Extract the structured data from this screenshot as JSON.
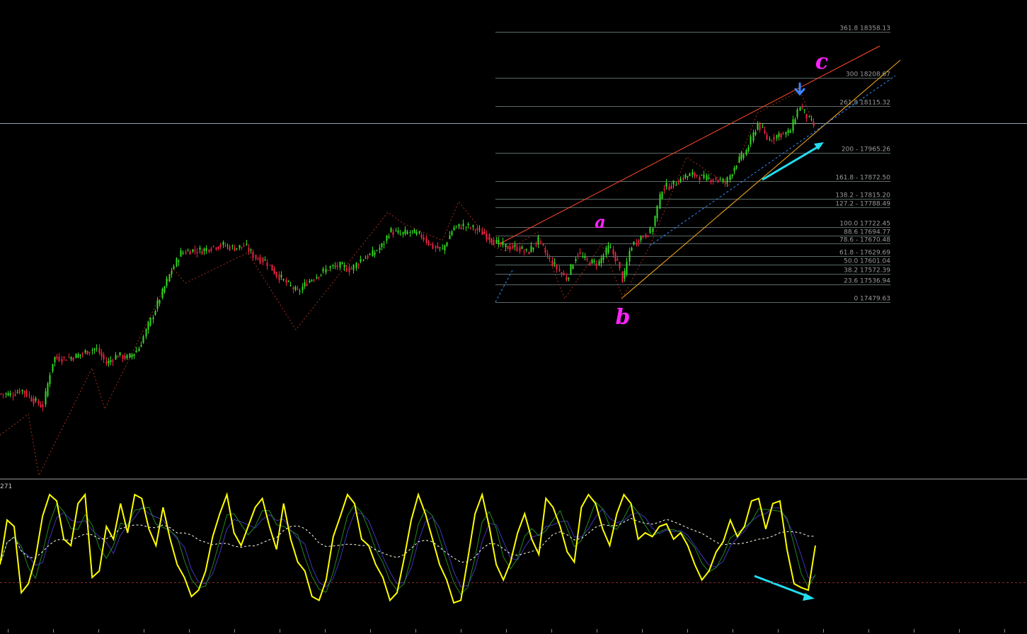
{
  "colors": {
    "background": "#000000",
    "bull_candle": "#33dd22",
    "bear_candle": "#ee2244",
    "fib_lines": "#5c6a6a",
    "fib_text": "#9a9a9a",
    "trend_upper": "#ff4a2a",
    "trend_lower": "#ffb020",
    "channel_dashed": "#2f8fff",
    "zigzag": "#a0301a",
    "crosshair": "#8ea4b0",
    "arrow": "#22ddee",
    "wave_label": "#ff22ff",
    "osc_main": "#ffff00",
    "osc_green": "#1f8a1f",
    "osc_blue": "#4433bb",
    "osc_signal": "#ffffee",
    "osc_zero": "#8a2a2a",
    "top_arrow": "#3a86ff"
  },
  "indicator_header": "271",
  "wave_labels": [
    "a",
    "b",
    "c"
  ],
  "chart_data": [
    {
      "type": "candlestick",
      "fib_levels": [
        {
          "label": "361.8 18358.13",
          "price": 18358.13
        },
        {
          "label": "300 18208.67",
          "price": 18208.67
        },
        {
          "label": "261.8 18115.32",
          "price": 18115.32
        },
        {
          "label": "200 - 17965.26",
          "price": 17965.26
        },
        {
          "label": "161.8 - 17872.50",
          "price": 17872.5
        },
        {
          "label": "138.2 - 17815.20",
          "price": 17815.2
        },
        {
          "label": "127.2 - 17788.49",
          "price": 17788.49
        },
        {
          "label": "100.0 17722.45",
          "price": 17722.45
        },
        {
          "label": "88.6 17694.77",
          "price": 17694.77
        },
        {
          "label": "78.6 - 17670.48",
          "price": 17670.48
        },
        {
          "label": "61.8 - 17629.69",
          "price": 17629.69
        },
        {
          "label": "50.0 17601.04",
          "price": 17601.04
        },
        {
          "label": "38.2 17572.39",
          "price": 17572.39
        },
        {
          "label": "23.6 17536.94",
          "price": 17536.94
        },
        {
          "label": "0 17479.63",
          "price": 17479.63
        }
      ],
      "price_path": [
        [
          0,
          17182
        ],
        [
          15,
          17180
        ],
        [
          30,
          17195
        ],
        [
          45,
          17165
        ],
        [
          60,
          17140
        ],
        [
          75,
          17300
        ],
        [
          90,
          17297
        ],
        [
          105,
          17302
        ],
        [
          120,
          17318
        ],
        [
          135,
          17330
        ],
        [
          150,
          17280
        ],
        [
          165,
          17308
        ],
        [
          180,
          17298
        ],
        [
          195,
          17328
        ],
        [
          210,
          17410
        ],
        [
          225,
          17490
        ],
        [
          240,
          17575
        ],
        [
          255,
          17640
        ],
        [
          270,
          17648
        ],
        [
          285,
          17647
        ],
        [
          300,
          17660
        ],
        [
          315,
          17665
        ],
        [
          330,
          17655
        ],
        [
          345,
          17663
        ],
        [
          360,
          17625
        ],
        [
          375,
          17612
        ],
        [
          390,
          17570
        ],
        [
          405,
          17540
        ],
        [
          420,
          17512
        ],
        [
          435,
          17548
        ],
        [
          450,
          17570
        ],
        [
          465,
          17592
        ],
        [
          480,
          17598
        ],
        [
          495,
          17585
        ],
        [
          510,
          17620
        ],
        [
          525,
          17635
        ],
        [
          540,
          17665
        ],
        [
          550,
          17712
        ],
        [
          565,
          17700
        ],
        [
          580,
          17708
        ],
        [
          595,
          17695
        ],
        [
          610,
          17660
        ],
        [
          625,
          17650
        ],
        [
          640,
          17722
        ],
        [
          655,
          17728
        ],
        [
          670,
          17718
        ],
        [
          685,
          17700
        ],
        [
          700,
          17672
        ],
        [
          715,
          17659
        ],
        [
          730,
          17657
        ],
        [
          745,
          17640
        ],
        [
          760,
          17680
        ],
        [
          775,
          17620
        ],
        [
          790,
          17580
        ],
        [
          800,
          17555
        ],
        [
          815,
          17640
        ],
        [
          830,
          17610
        ],
        [
          845,
          17606
        ],
        [
          860,
          17660
        ],
        [
          872,
          17610
        ],
        [
          880,
          17545
        ],
        [
          890,
          17660
        ],
        [
          905,
          17690
        ],
        [
          920,
          17710
        ],
        [
          935,
          17850
        ],
        [
          950,
          17860
        ],
        [
          965,
          17885
        ],
        [
          980,
          17895
        ],
        [
          995,
          17880
        ],
        [
          1010,
          17880
        ],
        [
          1025,
          17868
        ],
        [
          1040,
          17930
        ],
        [
          1055,
          17975
        ],
        [
          1070,
          18060
        ],
        [
          1085,
          18005
        ],
        [
          1100,
          18025
        ],
        [
          1115,
          18030
        ],
        [
          1125,
          18095
        ],
        [
          1130,
          18118
        ],
        [
          1140,
          18080
        ],
        [
          1152,
          18045
        ]
      ]
    },
    {
      "type": "line",
      "series": [
        {
          "values": [
            40,
            75,
            70,
            18,
            25,
            45,
            78,
            95,
            90,
            60,
            55,
            88,
            95,
            30,
            35,
            70,
            60,
            88,
            65,
            95,
            92,
            68,
            55,
            85,
            60,
            40,
            30,
            15,
            20,
            35,
            62,
            80,
            95,
            65,
            55,
            70,
            85,
            92,
            70,
            52,
            88,
            60,
            42,
            35,
            15,
            12,
            28,
            62,
            78,
            95,
            88,
            60,
            55,
            40,
            30,
            12,
            18,
            45,
            75,
            95,
            80,
            60,
            40,
            28,
            10,
            12,
            45,
            80,
            95,
            70,
            40,
            28,
            42,
            65,
            80,
            60,
            48,
            92,
            85,
            70,
            50,
            42,
            85,
            95,
            88,
            68,
            55,
            80,
            95,
            88,
            60,
            65,
            62,
            70,
            72,
            60,
            65,
            55,
            40,
            28,
            35,
            50,
            58,
            75,
            62,
            70,
            90,
            92,
            68,
            88,
            90,
            52,
            25,
            22,
            20,
            55
          ]
        }
      ]
    }
  ]
}
